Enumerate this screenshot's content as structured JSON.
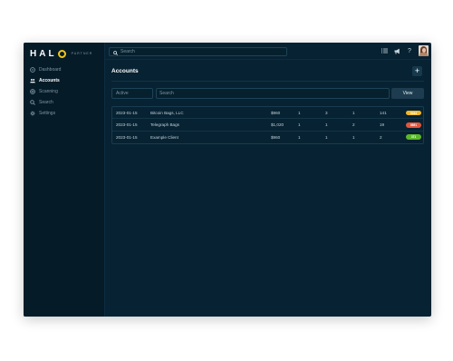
{
  "brand": {
    "name": "HAL",
    "o_letter": "O",
    "subtitle": "PARTNER"
  },
  "sidebar": {
    "items": [
      {
        "label": "Dashboard",
        "icon": "dashboard-icon",
        "active": false
      },
      {
        "label": "Accounts",
        "icon": "users-icon",
        "active": true
      },
      {
        "label": "Scanning",
        "icon": "scan-icon",
        "active": false
      },
      {
        "label": "Search",
        "icon": "search-icon",
        "active": false
      },
      {
        "label": "Settings",
        "icon": "gear-icon",
        "active": false
      }
    ]
  },
  "topbar": {
    "search_placeholder": "Search",
    "icons": [
      "list-icon",
      "megaphone-icon",
      "help-icon"
    ]
  },
  "page": {
    "title": "Accounts",
    "add_label": "+"
  },
  "filters": {
    "status_value": "Active",
    "search_placeholder": "Search",
    "view_label": "View"
  },
  "accounts": [
    {
      "date": "2023-01-15",
      "name": "Bitcoin Bags, LLC",
      "price": "$960",
      "n1": "1",
      "n2": "3",
      "n3": "1",
      "n4": "141",
      "badge": "5444",
      "badge_color": "#f0b72a"
    },
    {
      "date": "2023-01-15",
      "name": "Telegraph Bags",
      "price": "$1,020",
      "n1": "1",
      "n2": "1",
      "n3": "2",
      "n4": "19",
      "badge": "8891",
      "badge_color": "#e2553c"
    },
    {
      "date": "2023-01-15",
      "name": "Example Client",
      "price": "$960",
      "n1": "1",
      "n2": "1",
      "n3": "1",
      "n4": "2",
      "badge": "371",
      "badge_color": "#5cb82a"
    }
  ],
  "colors": {
    "background": "#072232",
    "sidebar": "#051b28",
    "accent_logo": "#f0c419"
  }
}
